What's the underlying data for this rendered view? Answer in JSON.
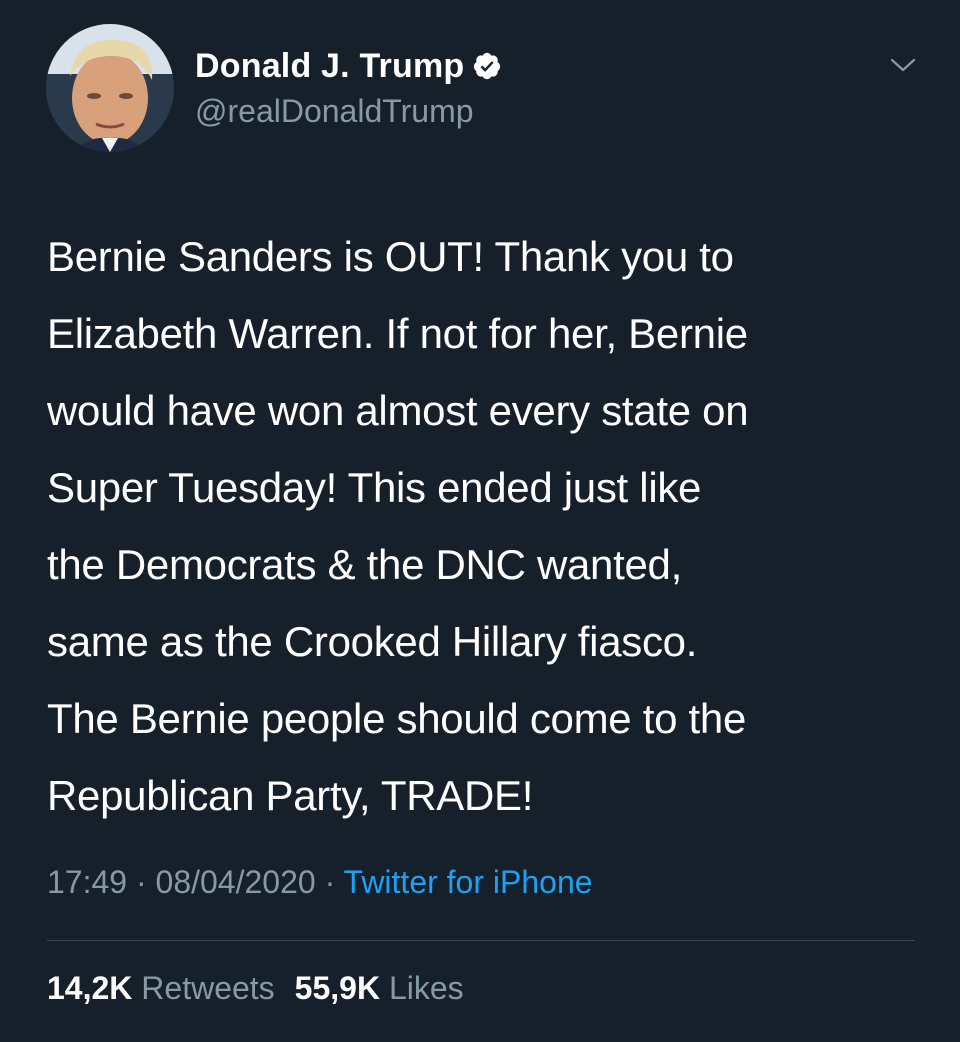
{
  "tweet": {
    "author": {
      "display_name": "Donald J. Trump",
      "handle": "@realDonaldTrump",
      "verified": true
    },
    "text": "Bernie Sanders is OUT! Thank you to\nElizabeth Warren. If not for her, Bernie\nwould have won almost every state on\nSuper Tuesday! This ended just like\nthe Democrats & the DNC wanted,\nsame as the Crooked Hillary fiasco.\nThe Bernie people should come to the\nRepublican Party, TRADE!",
    "time": "17:49",
    "separator": " · ",
    "date": "08/04/2020",
    "source": "Twitter for iPhone",
    "stats": {
      "retweets_count": "14,2K",
      "retweets_label": "Retweets",
      "likes_count": "55,9K",
      "likes_label": "Likes"
    }
  },
  "icons": {
    "verified": "verified-badge-icon",
    "menu": "chevron-down-icon"
  },
  "colors": {
    "background": "#15202b",
    "text_primary": "#ffffff",
    "text_secondary": "#8899a6",
    "link": "#1da1f2",
    "divider": "#38444d"
  }
}
